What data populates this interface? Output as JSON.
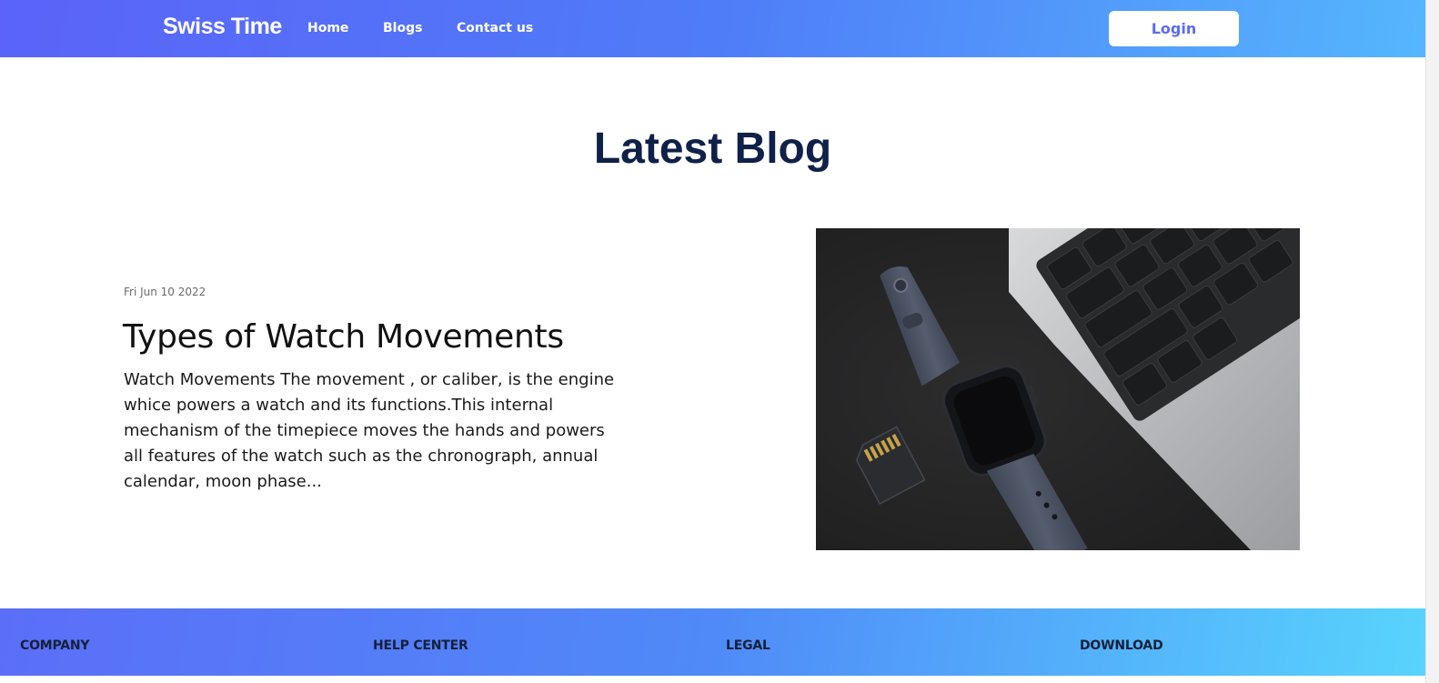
{
  "nav": {
    "brand": "Swiss Time",
    "links": [
      "Home",
      "Blogs",
      "Contact us"
    ],
    "login_label": "Login"
  },
  "main": {
    "section_title": "Latest Blog",
    "post": {
      "date": "Fri Jun 10 2022",
      "title": "Types of Watch Movements",
      "excerpt": "Watch Movements The movement , or caliber, is the engine whice powers a watch and its functions.This internal mechanism of the timepiece moves the hands and powers all features of the watch such as the chronograph, annual calendar, moon phase...",
      "image_subject": "smartwatch-laptop-sdcard-photo"
    }
  },
  "footer": {
    "columns": [
      "COMPANY",
      "HELP CENTER",
      "LEGAL",
      "DOWNLOAD"
    ]
  },
  "colors": {
    "nav_gradient_start": "#5b63f8",
    "nav_gradient_end": "#55b6fd",
    "heading": "#0f2148",
    "login_text": "#5b6cf0",
    "footer_gradient_end": "#58d4fd"
  }
}
